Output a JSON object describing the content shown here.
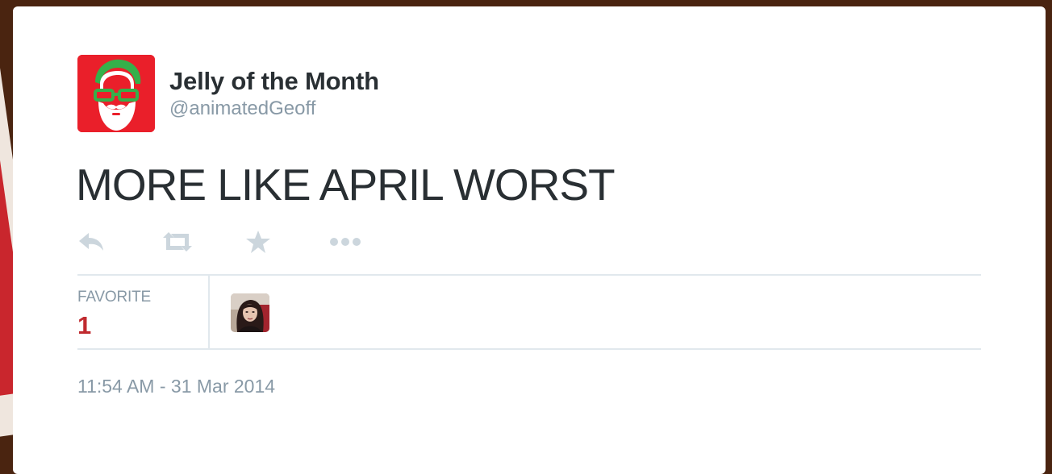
{
  "tweet": {
    "author": {
      "display_name": "Jelly of the Month",
      "handle": "@animatedGeoff",
      "avatar_icon": "red-bearded-man-glasses-avatar",
      "avatar_bg": "#ea1f2a"
    },
    "text": "MORE LIKE APRIL WORST",
    "actions": [
      {
        "icon": "reply-icon"
      },
      {
        "icon": "retweet-icon"
      },
      {
        "icon": "favorite-star-icon"
      },
      {
        "icon": "more-dots-icon"
      }
    ],
    "stats": {
      "label": "FAVORITE",
      "count": "1",
      "count_color": "#c02a2f"
    },
    "favoriter_avatar": "woman-dark-hair-avatar",
    "timestamp": "11:54 AM - 31 Mar 2014"
  },
  "colors": {
    "text_primary": "#292f33",
    "text_secondary": "#8899a6",
    "icon_gray": "#ccd6dd",
    "divider": "#e1e8ed",
    "page_background": "#4a2410"
  }
}
